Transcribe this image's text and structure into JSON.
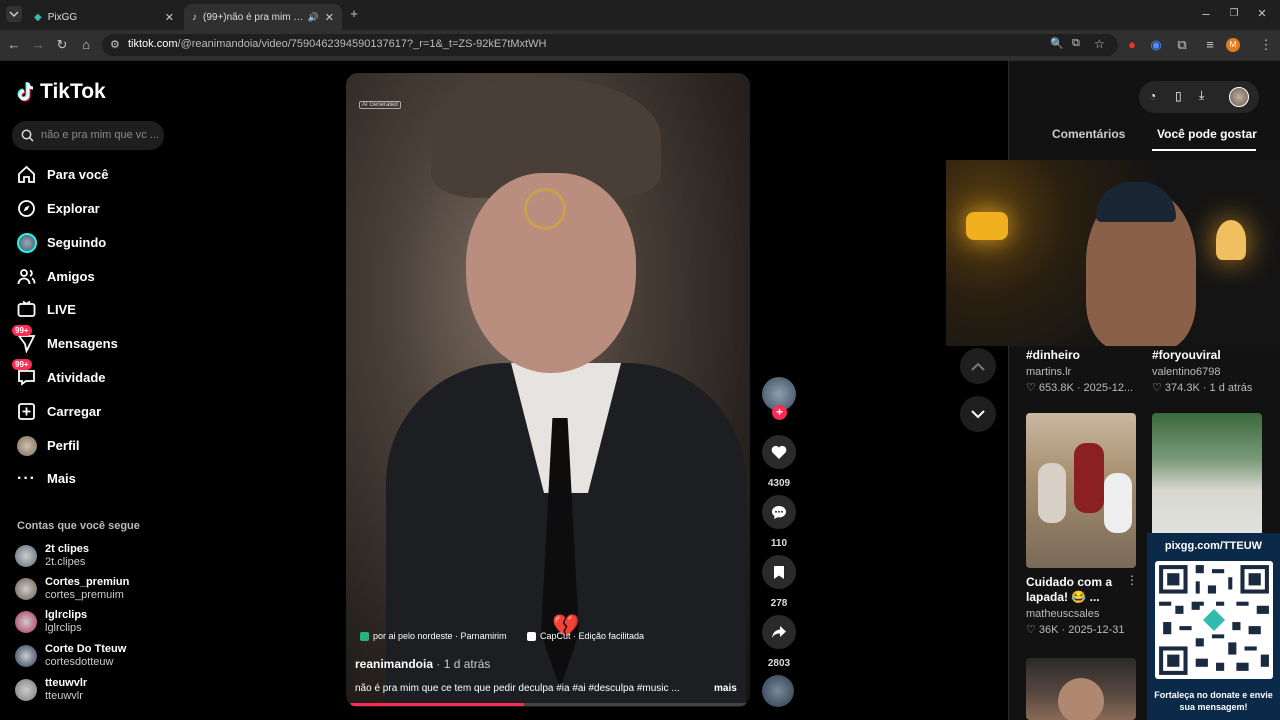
{
  "browser": {
    "tabs": [
      {
        "title": "PixGG"
      },
      {
        "title": "(99+)não é pra mim que ce"
      }
    ],
    "url_domain": "tiktok.com",
    "url_path": "/@reanimandoia/video/7590462394590137617?_r=1&_t=ZS-92kE7tMxtWH",
    "profile_initial": "M"
  },
  "sidebar": {
    "logo": "TikTok",
    "search_placeholder": "não e pra mim que vc ...",
    "nav": [
      {
        "label": "Para você",
        "icon": "home-icon"
      },
      {
        "label": "Explorar",
        "icon": "compass-icon"
      },
      {
        "label": "Seguindo",
        "icon": "following-avatar"
      },
      {
        "label": "Amigos",
        "icon": "friends-icon"
      },
      {
        "label": "LIVE",
        "icon": "live-icon"
      },
      {
        "label": "Mensagens",
        "icon": "messages-icon",
        "badge": "99+"
      },
      {
        "label": "Atividade",
        "icon": "activity-icon",
        "badge": "99+"
      },
      {
        "label": "Carregar",
        "icon": "upload-icon"
      },
      {
        "label": "Perfil",
        "icon": "profile-avatar"
      },
      {
        "label": "Mais",
        "icon": "more-icon"
      }
    ],
    "following_title": "Contas que você segue",
    "following": [
      {
        "name": "2t clipes",
        "handle": "2t.clipes",
        "color": "#5a6a7a"
      },
      {
        "name": "Cortes_premiun",
        "handle": "cortes_premuim",
        "color": "#6a5a4a"
      },
      {
        "name": "lglrclips",
        "handle": "lglrclips",
        "color": "#b03060"
      },
      {
        "name": "Corte Do Tteuw",
        "handle": "cortesdotteuw",
        "color": "#2a3a5a"
      },
      {
        "name": "tteuwvlr",
        "handle": "tteuwvlr",
        "color": "#7a7a7a"
      }
    ]
  },
  "video": {
    "ai_tag": "AI Generated",
    "location": "por ai pelo nordeste · Parnamirim",
    "capcut": "CapCut · Edição facilitada",
    "author": "reanimandoia",
    "time": " · 1 d atrás",
    "caption": "não é pra mim que ce tem que pedir deculpa #ia #ai #desculpa #music ...",
    "more": "mais",
    "progress": 0.44
  },
  "actions": {
    "likes": "4309",
    "comments": "110",
    "saves": "278",
    "shares": "2803"
  },
  "right_panel": {
    "tab_comments": "Comentários",
    "tab_suggested": "Você pode gostar",
    "cards": [
      {
        "title": "#dinheiro",
        "user": "martins.lr",
        "stats": "653.8K · 2025-12..."
      },
      {
        "title": "#foryouviral",
        "user": "valentino6798",
        "stats": "374.3K · 1 d atrás"
      },
      {
        "title": "Cuidado com a lapada! 😂 ...",
        "user": "matheuscsales",
        "stats": "36K · 2025-12-31"
      }
    ]
  },
  "overlay": {
    "pix_url": "pixgg.com/TTEUW",
    "pix_message": "Fortaleça no donate e envie sua mensagem!"
  },
  "colors": {
    "accent": "#fe2c55",
    "pix_bg": "#0b2a4a"
  }
}
